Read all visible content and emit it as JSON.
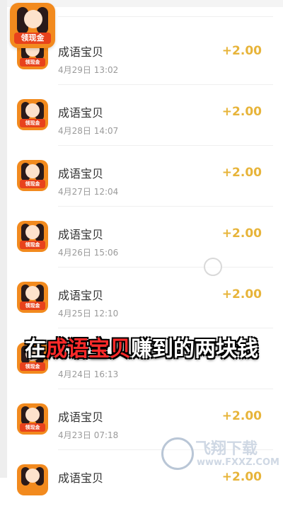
{
  "float_app": {
    "label": "领现金"
  },
  "records": [
    {
      "title": "",
      "time": "",
      "amount": ""
    },
    {
      "title": "成语宝贝",
      "time": "4月29日 13:02",
      "amount": "+2.00"
    },
    {
      "title": "成语宝贝",
      "time": "4月28日 14:07",
      "amount": "+2.00"
    },
    {
      "title": "成语宝贝",
      "time": "4月27日 12:04",
      "amount": "+2.00"
    },
    {
      "title": "成语宝贝",
      "time": "4月26日 15:06",
      "amount": "+2.00"
    },
    {
      "title": "成语宝贝",
      "time": "4月25日 12:10",
      "amount": "+2.00"
    },
    {
      "title": "",
      "time": "4月24日 16:13",
      "amount": ""
    },
    {
      "title": "成语宝贝",
      "time": "4月23日 07:18",
      "amount": "+2.00"
    },
    {
      "title": "成语宝贝",
      "time": "",
      "amount": "+2.00"
    }
  ],
  "icon_badge": "领现金",
  "caption": {
    "prefix": "在",
    "highlight": "成语宝贝",
    "suffix": "赚到的两块钱"
  },
  "watermark": {
    "brand": "飞翔下载",
    "site": "www.FXXZ.COM"
  },
  "colors": {
    "amount": "#e7b43a",
    "caption_highlight": "#ff2a2a",
    "app_icon": "#f28a1e"
  }
}
